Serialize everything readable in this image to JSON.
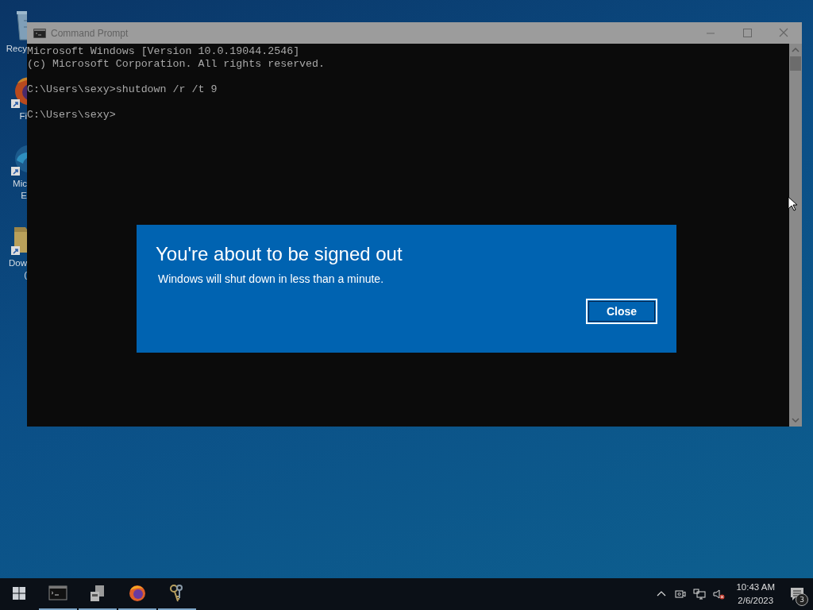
{
  "desktop_icons": [
    {
      "kind": "recycle-bin",
      "label_lines": [
        "Recy"
      ]
    },
    {
      "kind": "firefox",
      "label_lines": [
        "Fi"
      ]
    },
    {
      "kind": "edge",
      "label_lines": [
        "Mic",
        "E"
      ]
    },
    {
      "kind": "folder",
      "label_lines": [
        "Dow",
        "("
      ]
    }
  ],
  "window": {
    "title": "Command Prompt",
    "blocks": [
      [
        "Microsoft Windows [Version 10.0.19044.2546]",
        "(c) Microsoft Corporation. All rights reserved."
      ],
      [
        "C:\\Users\\sexy>shutdown /r /t 9"
      ],
      [
        "C:\\Users\\sexy>"
      ]
    ]
  },
  "dialog": {
    "title": "You're about to be signed out",
    "message": "Windows will shut down in less than a minute.",
    "button": {
      "label": "Close",
      "focused": true
    }
  },
  "taskbar": {
    "apps": [
      {
        "kind": "console",
        "running": true
      },
      {
        "kind": "server",
        "running": true
      },
      {
        "kind": "firefox",
        "running": true
      },
      {
        "kind": "keys",
        "running": true
      }
    ],
    "clock": {
      "time": "10:43 AM",
      "date": "2/6/2023"
    },
    "notification_count": "3"
  }
}
